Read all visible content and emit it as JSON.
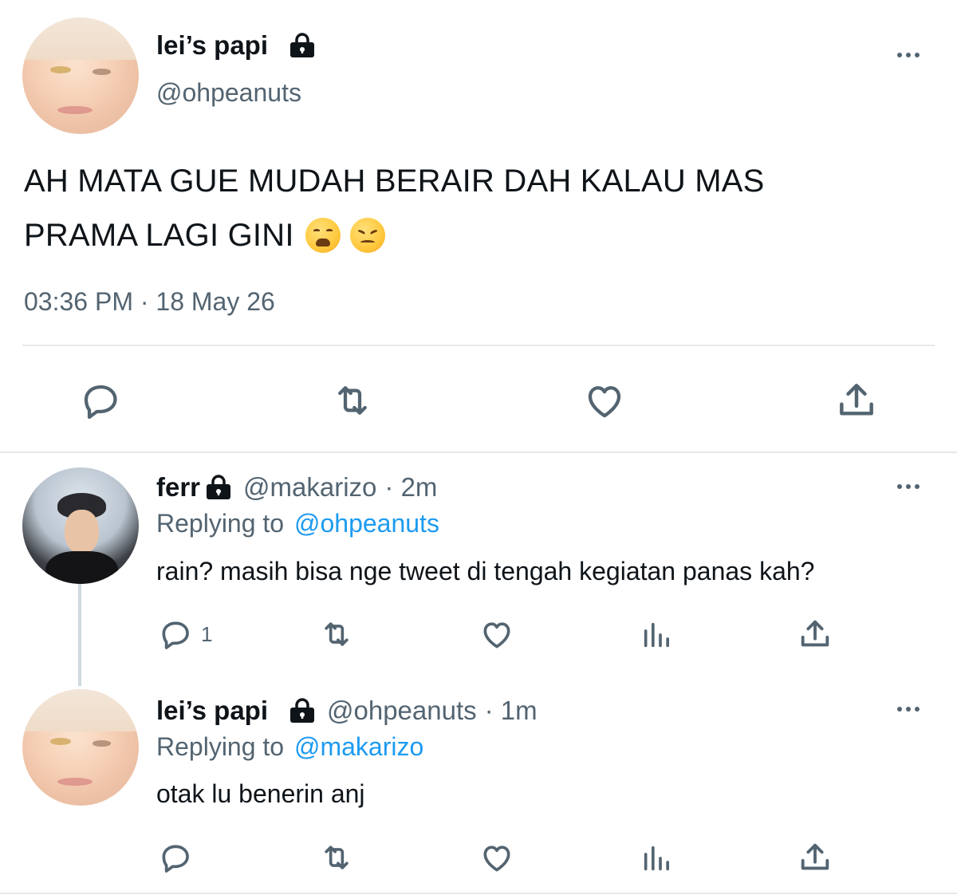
{
  "main_tweet": {
    "display_name": "lei’s papi",
    "handle": "@ohpeanuts",
    "text_line1": "AH MATA GUE MUDAH BERAIR DAH KALAU MAS",
    "text_line2": "PRAMA LAGI GINI",
    "emojis": [
      "weary-face-emoji",
      "confounded-face-emoji"
    ],
    "timestamp": "03:36 PM · 18 May 26"
  },
  "replies": [
    {
      "display_name": "ferr",
      "handle": "@makarizo",
      "time": "· 2m",
      "replying_prefix": "Replying to",
      "replying_to": "@ohpeanuts",
      "text": "rain? masih bisa nge tweet di tengah kegiatan panas kah?",
      "reply_count": "1"
    },
    {
      "display_name": "lei’s papi",
      "handle": "@ohpeanuts",
      "time": "· 1m",
      "replying_prefix": "Replying to",
      "replying_to": "@makarizo",
      "text": "otak lu benerin anj",
      "reply_count": ""
    }
  ],
  "colors": {
    "text": "#0f1419",
    "secondary": "#536471",
    "link": "#1d9bf0",
    "divider": "#e6e8eb"
  }
}
